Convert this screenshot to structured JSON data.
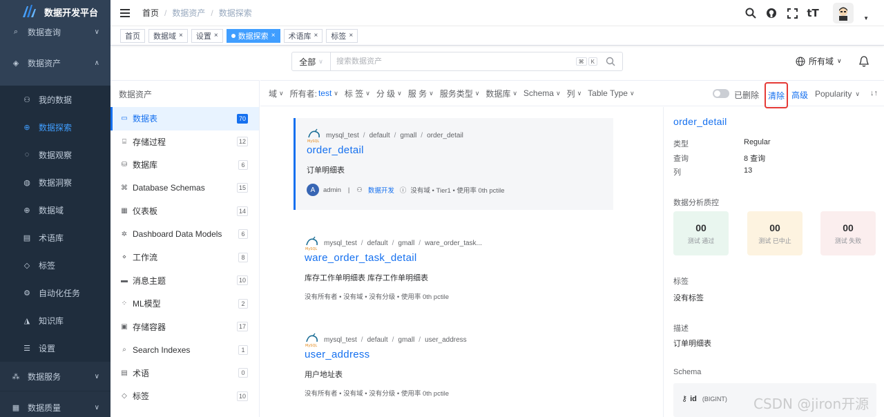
{
  "app": {
    "title": "数据开发平台"
  },
  "sidebar": {
    "items": [
      {
        "label": "数据查询",
        "icon": "search-icon",
        "level": "top"
      },
      {
        "label": "数据资产",
        "icon": "cube-icon",
        "level": "top"
      },
      {
        "label": "我的数据",
        "icon": "user-data-icon",
        "level": "sub"
      },
      {
        "label": "数据探索",
        "icon": "globe-icon",
        "level": "sub",
        "active": true
      },
      {
        "label": "数据观察",
        "icon": "observe-icon",
        "level": "sub"
      },
      {
        "label": "数据洞察",
        "icon": "bulb-icon",
        "level": "sub"
      },
      {
        "label": "数据域",
        "icon": "domain-icon",
        "level": "sub"
      },
      {
        "label": "术语库",
        "icon": "book-icon",
        "level": "sub"
      },
      {
        "label": "标签",
        "icon": "tag-icon",
        "level": "sub"
      },
      {
        "label": "自动化任务",
        "icon": "automation-icon",
        "level": "sub"
      },
      {
        "label": "知识库",
        "icon": "knowledge-icon",
        "level": "sub"
      },
      {
        "label": "设置",
        "icon": "settings-icon",
        "level": "sub"
      },
      {
        "label": "数据服务",
        "icon": "service-icon",
        "level": "top"
      },
      {
        "label": "数据质量",
        "icon": "quality-icon",
        "level": "top"
      }
    ]
  },
  "breadcrumb": {
    "home": "首页",
    "parent": "数据资产",
    "current": "数据探索"
  },
  "tags": [
    {
      "label": "首页",
      "closable": false
    },
    {
      "label": "数据域",
      "closable": true
    },
    {
      "label": "设置",
      "closable": true
    },
    {
      "label": "数据探索",
      "closable": true,
      "active": true
    },
    {
      "label": "术语库",
      "closable": true
    },
    {
      "label": "标签",
      "closable": true
    }
  ],
  "search": {
    "scope": "全部",
    "placeholder": "搜索数据资产",
    "shortcut_cmd": "⌘",
    "shortcut_key": "K",
    "domain_label": "所有域"
  },
  "left_panel": {
    "title": "数据资产",
    "items": [
      {
        "label": "数据表",
        "count": "70",
        "icon": "table-icon",
        "active": true
      },
      {
        "label": "存储过程",
        "count": "12",
        "icon": "procedure-icon"
      },
      {
        "label": "数据库",
        "count": "6",
        "icon": "database-icon"
      },
      {
        "label": "Database Schemas",
        "count": "15",
        "icon": "schema-icon"
      },
      {
        "label": "仪表板",
        "count": "14",
        "icon": "dashboard-icon"
      },
      {
        "label": "Dashboard Data Models",
        "count": "6",
        "icon": "data-model-icon"
      },
      {
        "label": "工作流",
        "count": "8",
        "icon": "pipeline-icon"
      },
      {
        "label": "消息主题",
        "count": "10",
        "icon": "topic-icon"
      },
      {
        "label": "ML模型",
        "count": "2",
        "icon": "ml-model-icon"
      },
      {
        "label": "存储容器",
        "count": "17",
        "icon": "container-icon"
      },
      {
        "label": "Search Indexes",
        "count": "1",
        "icon": "search-index-icon"
      },
      {
        "label": "术语",
        "count": "0",
        "icon": "glossary-icon"
      },
      {
        "label": "标签",
        "count": "10",
        "icon": "tag-icon"
      }
    ]
  },
  "filters": {
    "items": [
      {
        "label": "域"
      },
      {
        "label": "所有者:",
        "value": "test"
      },
      {
        "label": "标 签"
      },
      {
        "label": "分 级"
      },
      {
        "label": "服 务"
      },
      {
        "label": "服务类型"
      },
      {
        "label": "数据库"
      },
      {
        "label": "Schema"
      },
      {
        "label": "列"
      },
      {
        "label": "Table Type"
      }
    ],
    "deleted_label": "已删除",
    "clear_label": "清除",
    "advanced_label": "高级",
    "sort_label": "Popularity"
  },
  "results": [
    {
      "path": [
        "mysql_test",
        "default",
        "gmall",
        "order_detail"
      ],
      "title": "order_detail",
      "desc": "订单明细表",
      "owner_initial": "A",
      "owner": "admin",
      "domain_link": "数据开发",
      "meta": "没有域 • Tier1 • 使用率 0th pctile"
    },
    {
      "path": [
        "mysql_test",
        "default",
        "gmall",
        "ware_order_task..."
      ],
      "title": "ware_order_task_detail",
      "desc": "库存工作单明细表 库存工作单明细表",
      "meta": "没有所有者 • 没有域 • 没有分级 • 使用率 0th pctile"
    },
    {
      "path": [
        "mysql_test",
        "default",
        "gmall",
        "user_address"
      ],
      "title": "user_address",
      "desc": "用户地址表",
      "meta": "没有所有者 • 没有域 • 没有分级 • 使用率 0th pctile"
    }
  ],
  "details": {
    "title": "order_detail",
    "rows": [
      {
        "label": "类型",
        "value": "Regular"
      },
      {
        "label": "查询",
        "value": "8 查询"
      },
      {
        "label": "列",
        "value": "13"
      }
    ],
    "quality_title": "数据分析质控",
    "quality": [
      {
        "num": "00",
        "label": "测试 通过",
        "color": "#e9f6ef"
      },
      {
        "num": "00",
        "label": "测试 已中止",
        "color": "#fdf3e0"
      },
      {
        "num": "00",
        "label": "测试 失败",
        "color": "#fbeeee"
      }
    ],
    "tags_title": "标签",
    "tags_value": "没有标签",
    "desc_title": "描述",
    "desc_value": "订单明细表",
    "schema_title": "Schema",
    "schema_col": "id",
    "schema_type": "(BIGINT)"
  },
  "watermark": "CSDN @jiron开源"
}
